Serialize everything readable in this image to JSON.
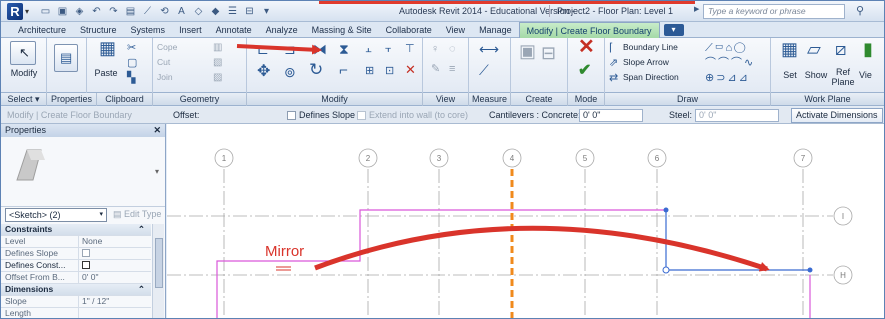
{
  "titlebar": {
    "title": "Autodesk Revit 2014 - Educational Version -",
    "view": "Project2 - Floor Plan: Level 1",
    "search_placeholder": "Type a keyword or phrase"
  },
  "tabs": [
    {
      "label": "Architecture"
    },
    {
      "label": "Structure"
    },
    {
      "label": "Systems"
    },
    {
      "label": "Insert"
    },
    {
      "label": "Annotate"
    },
    {
      "label": "Analyze"
    },
    {
      "label": "Massing & Site"
    },
    {
      "label": "Collaborate"
    },
    {
      "label": "View"
    },
    {
      "label": "Manage"
    },
    {
      "label": "Modify | Create Floor Boundary"
    }
  ],
  "ribbon": {
    "modify": "Modify",
    "paste": "Paste",
    "cope": "Cope",
    "cut": "Cut",
    "join": "Join",
    "boundary_line": "Boundary Line",
    "slope_arrow": "Slope Arrow",
    "span_direction": "Span Direction",
    "set": "Set",
    "show": "Show",
    "ref_plane": "Ref Plane",
    "viewer": "Vie"
  },
  "panel_labels": {
    "select": "Select",
    "properties": "Properties",
    "clipboard": "Clipboard",
    "geometry": "Geometry",
    "modify": "Modify",
    "view": "View",
    "measure": "Measure",
    "create": "Create",
    "mode": "Mode",
    "draw": "Draw",
    "work_plane": "Work Plane"
  },
  "options_bar": {
    "context": "Modify | Create Floor Boundary",
    "offset_label": "Offset:",
    "defines_slope": "Defines Slope",
    "extend": "Extend into wall (to core)",
    "cantilevers": "Cantilevers : Concrete:",
    "concrete_value": "0'  0\"",
    "steel_label": "Steel:",
    "steel_value": "0'  0\"",
    "activate_dimensions": "Activate Dimensions"
  },
  "properties": {
    "title": "Properties",
    "selector": "<Sketch> (2)",
    "edit_type": "Edit Type",
    "groups": {
      "constraints": "Constraints",
      "dimensions": "Dimensions"
    },
    "rows": {
      "level_k": "Level",
      "level_v": "None",
      "defines_slope_k": "Defines Slope",
      "defines_const_k": "Defines Const...",
      "offset_k": "Offset From B...",
      "offset_v": "0'  0\"",
      "slope_k": "Slope",
      "slope_v": "1\" / 12\"",
      "length_k": "Length"
    }
  },
  "canvas": {
    "annotation": "Mirror",
    "grid_numbers": [
      "1",
      "2",
      "3",
      "4",
      "5",
      "6",
      "7"
    ],
    "grid_letters": [
      "I",
      "H"
    ]
  },
  "colors": {
    "annotation_red": "#d9342b",
    "axis_orange": "#f08a1c",
    "sketch_magenta": "#d958d9",
    "selected_blue": "#3a6bd1"
  }
}
